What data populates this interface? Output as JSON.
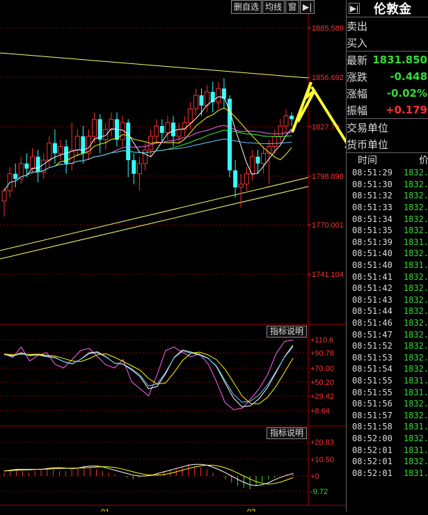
{
  "toolbar": {
    "delete_label": "删自选",
    "ma_label": "均线",
    "window_label": "窗",
    "arrow_label": "▶|"
  },
  "price_axis": [
    "1885.589",
    "1856.692",
    "1827.79",
    "1798.898",
    "1770.001",
    "1741.104"
  ],
  "osc_axis": [
    "+110.6",
    "+90.78",
    "+70.00",
    "+50.20",
    "+29.42",
    "+8.64"
  ],
  "macd_axis": [
    "+20.83",
    "+10.50",
    "+0",
    "-9.72"
  ],
  "indicator_label": "指标说明",
  "date_labels": [
    "01",
    "02"
  ],
  "colors": {
    "up": "#ff3030",
    "down": "#33ffff",
    "bg": "#000000",
    "grid": "#8b0000",
    "green": "#33dd33",
    "yellow": "#ffff00"
  },
  "panel": {
    "title_arrow": "▶|",
    "title": "伦敦金",
    "rows": [
      {
        "label": "卖出",
        "value": "",
        "color": "#ddd"
      },
      {
        "label": "买入",
        "value": "",
        "color": "#ddd"
      },
      {
        "label": "最新",
        "value": "1831.850",
        "color": "#33dd33"
      },
      {
        "label": "涨跌",
        "value": "-0.448",
        "color": "#33dd33"
      },
      {
        "label": "涨幅",
        "value": "-0.02%",
        "color": "#33dd33"
      },
      {
        "label": "振幅",
        "value": "+0.179",
        "color": "#ff3030"
      },
      {
        "label": "交易单位",
        "value": "",
        "color": "#ddd"
      },
      {
        "label": "货币单位",
        "value": "",
        "color": "#ddd"
      }
    ],
    "trade_header": {
      "time": "时间",
      "price": "价"
    },
    "trades": [
      {
        "time": "08:51:29",
        "price": "1832."
      },
      {
        "time": "08:51:30",
        "price": "1832."
      },
      {
        "time": "08:51:32",
        "price": "1832."
      },
      {
        "time": "08:51:33",
        "price": "1832."
      },
      {
        "time": "08:51:34",
        "price": "1832."
      },
      {
        "time": "08:51:35",
        "price": "1832."
      },
      {
        "time": "08:51:39",
        "price": "1831."
      },
      {
        "time": "08:51:40",
        "price": "1832."
      },
      {
        "time": "08:51:40",
        "price": "1831."
      },
      {
        "time": "08:51:41",
        "price": "1832."
      },
      {
        "time": "08:51:42",
        "price": "1832."
      },
      {
        "time": "08:51:43",
        "price": "1832."
      },
      {
        "time": "08:51:44",
        "price": "1832."
      },
      {
        "time": "08:51:46",
        "price": "1832."
      },
      {
        "time": "08:51:47",
        "price": "1832."
      },
      {
        "time": "08:51:52",
        "price": "1832."
      },
      {
        "time": "08:51:53",
        "price": "1832."
      },
      {
        "time": "08:51:54",
        "price": "1832."
      },
      {
        "time": "08:51:55",
        "price": "1831."
      },
      {
        "time": "08:51:55",
        "price": "1831."
      },
      {
        "time": "08:51:56",
        "price": "1832."
      },
      {
        "time": "08:51:57",
        "price": "1832."
      },
      {
        "time": "08:51:58",
        "price": "1831."
      },
      {
        "time": "08:52:00",
        "price": "1832."
      },
      {
        "time": "08:52:01",
        "price": "1831."
      },
      {
        "time": "08:52:01",
        "price": "1832."
      },
      {
        "time": "08:52:01",
        "price": "1831."
      }
    ]
  },
  "candles": [
    [
      1784,
      1790,
      1775,
      1792
    ],
    [
      1790,
      1800,
      1786,
      1804
    ],
    [
      1800,
      1797,
      1792,
      1806
    ],
    [
      1797,
      1806,
      1794,
      1810
    ],
    [
      1806,
      1803,
      1798,
      1812
    ],
    [
      1803,
      1810,
      1800,
      1815
    ],
    [
      1810,
      1801,
      1795,
      1814
    ],
    [
      1801,
      1808,
      1797,
      1812
    ],
    [
      1808,
      1818,
      1804,
      1822
    ],
    [
      1818,
      1812,
      1806,
      1826
    ],
    [
      1812,
      1816,
      1808,
      1820
    ],
    [
      1816,
      1806,
      1800,
      1820
    ],
    [
      1806,
      1814,
      1802,
      1830
    ],
    [
      1814,
      1822,
      1810,
      1826
    ],
    [
      1822,
      1812,
      1806,
      1828
    ],
    [
      1812,
      1822,
      1808,
      1826
    ],
    [
      1822,
      1832,
      1818,
      1836
    ],
    [
      1832,
      1820,
      1812,
      1835
    ],
    [
      1820,
      1826,
      1814,
      1830
    ],
    [
      1826,
      1832,
      1822,
      1836
    ],
    [
      1832,
      1820,
      1816,
      1836
    ],
    [
      1820,
      1830,
      1816,
      1834
    ],
    [
      1830,
      1808,
      1798,
      1832
    ],
    [
      1808,
      1800,
      1794,
      1812
    ],
    [
      1800,
      1806,
      1790,
      1810
    ],
    [
      1806,
      1814,
      1802,
      1818
    ],
    [
      1814,
      1822,
      1810,
      1826
    ],
    [
      1822,
      1828,
      1818,
      1832
    ],
    [
      1828,
      1824,
      1818,
      1832
    ],
    [
      1824,
      1830,
      1820,
      1834
    ],
    [
      1830,
      1822,
      1816,
      1834
    ],
    [
      1822,
      1826,
      1818,
      1830
    ],
    [
      1826,
      1830,
      1822,
      1834
    ],
    [
      1830,
      1838,
      1826,
      1842
    ],
    [
      1838,
      1846,
      1834,
      1850
    ],
    [
      1846,
      1840,
      1834,
      1850
    ],
    [
      1840,
      1848,
      1836,
      1852
    ],
    [
      1848,
      1842,
      1836,
      1854
    ],
    [
      1842,
      1850,
      1838,
      1854
    ],
    [
      1850,
      1844,
      1838,
      1856
    ],
    [
      1844,
      1802,
      1798,
      1846
    ],
    [
      1802,
      1792,
      1786,
      1808
    ],
    [
      1792,
      1794,
      1780,
      1800
    ],
    [
      1794,
      1800,
      1790,
      1804
    ],
    [
      1800,
      1810,
      1796,
      1814
    ],
    [
      1810,
      1806,
      1800,
      1814
    ],
    [
      1806,
      1812,
      1800,
      1816
    ],
    [
      1812,
      1816,
      1794,
      1820
    ],
    [
      1816,
      1822,
      1812,
      1826
    ],
    [
      1822,
      1828,
      1818,
      1832
    ],
    [
      1828,
      1834,
      1824,
      1838
    ],
    [
      1834,
      1832,
      1828,
      1836
    ]
  ]
}
